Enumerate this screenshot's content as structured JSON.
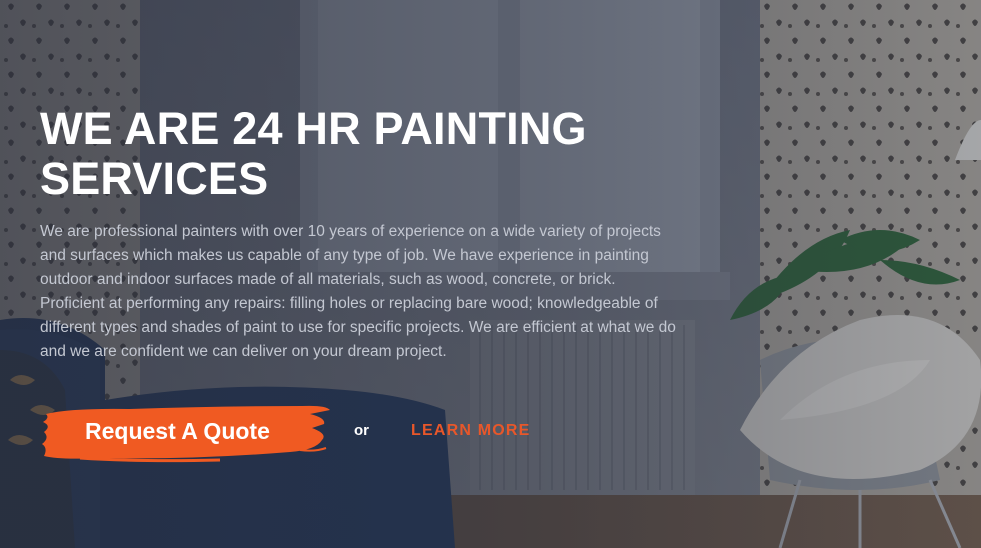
{
  "hero": {
    "title_lines": [
      "WE ARE 24 HR PAINTING",
      "SERVICES"
    ],
    "description_lines": [
      "We are professional painters with over 10 years of experience on a wide variety of projects",
      "and surfaces which makes us capable of any type of job. We have experience in painting",
      "outdoor and indoor surfaces made of all materials, such as wood, concrete, or brick.",
      "Proficient at performing any repairs: filling holes or replacing bare wood; knowledgeable of",
      "different types and shades of paint to use for specific projects. We are efficient at what we do",
      "and we are confident we can deliver on your dream project."
    ],
    "quote_button_label": "Request A Quote",
    "or_text": "or",
    "learn_more_label": "LEARN MORE",
    "background_icon": "living-room-photo",
    "colors": {
      "accent": "#f05a22",
      "link": "#e8572a",
      "title": "#ffffff",
      "body_text": "#c4c8d2"
    }
  }
}
